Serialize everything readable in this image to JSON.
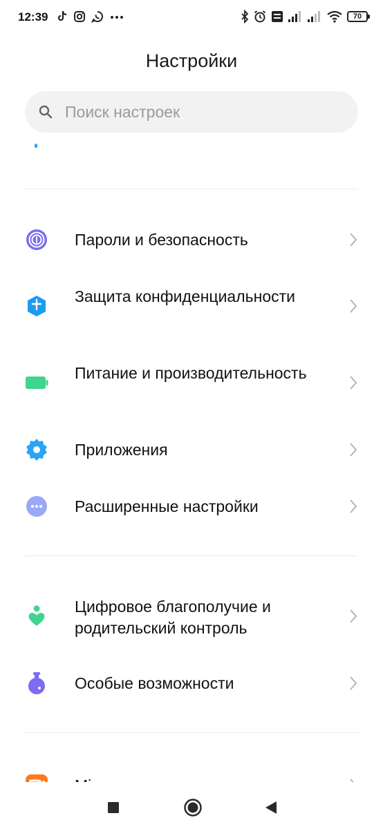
{
  "status_bar": {
    "time": "12:39",
    "battery": "70"
  },
  "header": {
    "title": "Настройки"
  },
  "search": {
    "placeholder": "Поиск настроек"
  },
  "items": [
    {
      "label": "Пароли и безопасность",
      "icon": "fingerprint-icon",
      "color": "#7b6cf0"
    },
    {
      "label": "Защита конфиденциальности",
      "icon": "privacy-shield-icon",
      "color": "#1e9bf0"
    },
    {
      "label": "Питание и производительность",
      "icon": "battery-icon",
      "color": "#3dd68c"
    },
    {
      "label": "Приложения",
      "icon": "gear-icon",
      "color": "#2aa4f4"
    },
    {
      "label": "Расширенные настройки",
      "icon": "more-dots-icon",
      "color": "#9aa8f5"
    },
    {
      "label": "Цифровое благополучие и родительский контроль",
      "icon": "wellbeing-icon",
      "color": "#3dd68c"
    },
    {
      "label": "Особые возможности",
      "icon": "accessibility-flask-icon",
      "color": "#7b6cf0"
    },
    {
      "label": "Mi аккаунт",
      "icon": "mi-logo-icon",
      "color": "#ff7a1a"
    }
  ]
}
